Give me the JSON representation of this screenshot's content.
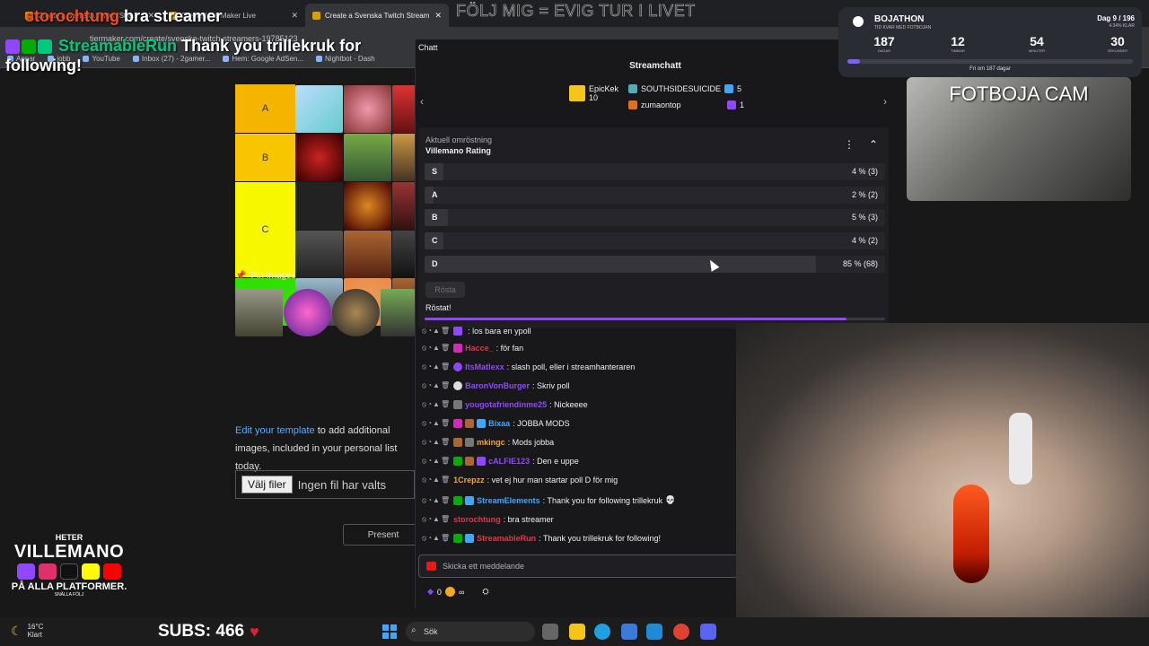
{
  "browser": {
    "tabs": [
      {
        "label": "Create a Svenska Twitch Stre..."
      },
      {
        "label": "Create | TierMaker Live"
      },
      {
        "label": "Create a Svenska Twitch Stream"
      }
    ],
    "url": "tiermaker.com/create/svenska-twitch-streamers-19785123",
    "bookmarks": [
      "Appar",
      "jobb",
      "YouTube",
      "Inbox (27) - 2gamer...",
      "Hem: Google AdSen...",
      "Nightbot - Dash"
    ]
  },
  "overlay": {
    "follow1_user": "storochtung",
    "follow1_text": "bra streamer",
    "follow2_user": "StreamableRun",
    "follow2_text": "Thank you trillekruk for following!",
    "slogan": "FÖLJ MIG = EVIG TUR I LIVET",
    "cam_label": "FOTBOJA CAM",
    "subs_label": "SUBS: 466",
    "social": {
      "heter": "HETER",
      "name": "VILLEMANO",
      "platforms": "PÅ ALLA PLATFORMER.",
      "small": "SNÄLLA FÖLJ"
    }
  },
  "bojathon": {
    "title": "BOJATHON",
    "subtitle": "TID KVAR MED FOTBOJAN",
    "day": "Dag 9 / 196",
    "pct": "4.34% KLAR",
    "counters": [
      {
        "value": "187",
        "unit": "DAGAR"
      },
      {
        "value": "12",
        "unit": "TIMMAR"
      },
      {
        "value": "54",
        "unit": "MINUTER"
      },
      {
        "value": "30",
        "unit": "SEKUNDER"
      }
    ],
    "progress": 0.0434,
    "footer": "Fri om 187 dagar"
  },
  "tierlist": {
    "tiers": [
      {
        "label": "A",
        "color": "#f4b400"
      },
      {
        "label": "B",
        "color": "#f7c600"
      },
      {
        "label": "C",
        "color": "#f7f700"
      },
      {
        "label": "D",
        "color": "#32e000"
      }
    ],
    "pin_title": "Pin Images",
    "edit_link": "Edit your template",
    "edit_text": " to add additional images, included in your personal list today.",
    "file_button": "Välj filer",
    "file_text": "Ingen fil har valts",
    "present_button": "Present"
  },
  "chat": {
    "tab_label": "Chatt",
    "title": "Streamchatt",
    "gifters": [
      {
        "name": "EpicKek",
        "count": "10"
      },
      {
        "name": "SOUTHSIDESUICIDE",
        "count": "5"
      },
      {
        "name": "zumaontop",
        "count": "1"
      }
    ],
    "poll": {
      "subtitle": "Aktuell omröstning",
      "title": "Villemano Rating",
      "options": [
        {
          "label": "S",
          "result": "4 % (3)",
          "pct": 4
        },
        {
          "label": "A",
          "result": "2 % (2)",
          "pct": 2
        },
        {
          "label": "B",
          "result": "5 % (3)",
          "pct": 5
        },
        {
          "label": "C",
          "result": "4 % (2)",
          "pct": 4
        },
        {
          "label": "D",
          "result": "85 % (68)",
          "pct": 85
        }
      ],
      "vote_button": "Rösta",
      "voted_text": "Röstat!"
    },
    "messages": [
      {
        "user": "",
        "color": "#9147ff",
        "text": ": los bara en ypoll"
      },
      {
        "user": "Hacce_",
        "color": "#e3344a",
        "text": ": för fan"
      },
      {
        "user": "ItsMatlexx",
        "color": "#9147ff",
        "text": ": slash poll, eller i streamhanteraren"
      },
      {
        "user": "BaronVonBurger",
        "color": "#9147ff",
        "text": ": Skriv poll"
      },
      {
        "user": "yougotafriendinme25",
        "color": "#9147ff",
        "text": ": Nickeeee"
      },
      {
        "user": "Bixaa",
        "color": "#3ea6ff",
        "text": ": JOBBA MODS"
      },
      {
        "user": "mkingc",
        "color": "#f5a623",
        "text": ": Mods jobba"
      },
      {
        "user": "cALFIE123",
        "color": "#9147ff",
        "text": ": Den e uppe"
      },
      {
        "user": "1Crepzz",
        "color": "#f5a623",
        "text": ": vet ej hur man startar poll D för mig"
      },
      {
        "user": "StreamElements",
        "color": "#3ea6ff",
        "text": ": Thank you for following trillekruk"
      },
      {
        "user": "storochtung",
        "color": "#e3344a",
        "text": ": bra streamer"
      },
      {
        "user": "StreamableRun",
        "color": "#e3344a",
        "text": ": Thank you trillekruk for following!"
      }
    ],
    "input_placeholder": "Skicka ett meddelande",
    "points": "0",
    "points_suffix": "∞"
  },
  "taskbar": {
    "temp": "16°C",
    "weather": "Klart",
    "search": "Sök"
  }
}
